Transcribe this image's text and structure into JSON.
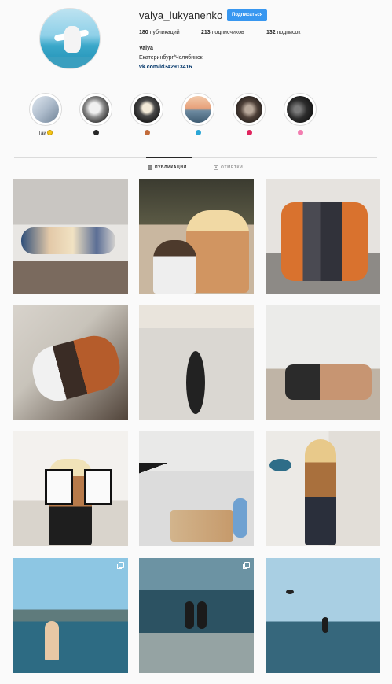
{
  "profile": {
    "username": "valya_lukyanenko",
    "follow_label": "Подписаться",
    "stats": [
      {
        "count": "180",
        "label": "публикаций"
      },
      {
        "count": "213",
        "label": "подписчиков"
      },
      {
        "count": "132",
        "label": "подписок"
      }
    ],
    "full_name": "Valya",
    "bio": "Екатеринбург/Челябинск",
    "link": "vk.com/id342913416"
  },
  "highlights": [
    {
      "label": "Тай",
      "emoji_color": "#f5c518",
      "icon": "sun-emoji-icon"
    },
    {
      "label": "",
      "emoji_color": "#262626",
      "icon": "black-heart-emoji-icon"
    },
    {
      "label": "",
      "emoji_color": "#c26b3a",
      "icon": "face-emoji-icon"
    },
    {
      "label": "",
      "emoji_color": "#2aa6d6",
      "icon": "wave-emoji-icon"
    },
    {
      "label": "",
      "emoji_color": "#e0245e",
      "icon": "red-heart-emoji-icon"
    },
    {
      "label": "",
      "emoji_color": "#f27db0",
      "icon": "flower-emoji-icon"
    }
  ],
  "tabs": {
    "posts": "ПУБЛИКАЦИИ",
    "tagged": "ОТМЕТКИ"
  },
  "colors": {
    "accent": "#3897f0",
    "link": "#003569",
    "border": "#dbdbdb"
  }
}
